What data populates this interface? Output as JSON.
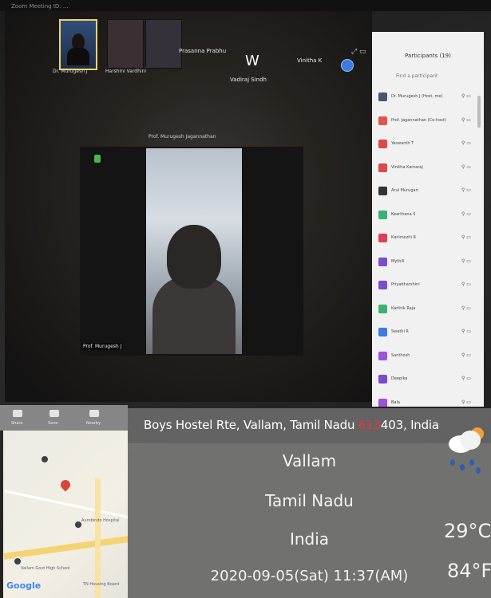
{
  "window": {
    "title": "Zoom Meeting ID: ..."
  },
  "video_strip": {
    "thumbs": [
      {
        "label": "Dr. Murugesh J"
      },
      {
        "label": "Harshini Vardhini"
      },
      {
        "label": ""
      }
    ],
    "name_tiles": [
      "Prasanna Prabhu",
      "Vadiraj Sindh",
      "Vinitha K"
    ],
    "w_letter": "W"
  },
  "speaker": {
    "caption": "Prof. Murugesh Jagannathan",
    "name_tag": "Prof. Murugesh J"
  },
  "participants_panel": {
    "title": "Participants (19)",
    "subtitle": "Find a participant",
    "rows": [
      {
        "name": "Dr. Murugesh J (Host, me)",
        "color": "#4b5563"
      },
      {
        "name": "Prof. Jagannathan (Co-host)",
        "color": "#e05546"
      },
      {
        "name": "Yaswanth T",
        "color": "#e04848"
      },
      {
        "name": "Vinitha Kamaraj",
        "color": "#d94a4a"
      },
      {
        "name": "Arul Murugan",
        "color": "#333333"
      },
      {
        "name": "Keerthana S",
        "color": "#3bb273"
      },
      {
        "name": "Kanimozhi R",
        "color": "#dd3f55"
      },
      {
        "name": "Mythili",
        "color": "#7a4ec9"
      },
      {
        "name": "Priyadharshini",
        "color": "#7a4ec9"
      },
      {
        "name": "Karthik Raja",
        "color": "#3bb273"
      },
      {
        "name": "Swathi R",
        "color": "#3d7be0"
      },
      {
        "name": "Santhosh",
        "color": "#9a55d9"
      },
      {
        "name": "Deepika",
        "color": "#7a4ec9"
      },
      {
        "name": "Bala",
        "color": "#9a55d9"
      }
    ]
  },
  "map_toolbar": {
    "items": [
      "Share",
      "Save",
      "Nearby"
    ]
  },
  "map": {
    "labels": [
      "Aurobindo Hospital",
      "Vallam Govt High School",
      "TN Housing Board"
    ],
    "brand": "Google"
  },
  "geo_tag": {
    "address_pre": "Boys Hostel Rte, Vallam, Tamil Nadu ",
    "address_red": "613",
    "address_mid": "403",
    "address_post": ", India",
    "city": "Vallam",
    "state": "Tamil Nadu",
    "country": "India",
    "datetime": "2020-09-05(Sat)  11:37(AM)",
    "temp_c": "29°C",
    "temp_f": "84°F",
    "weather_icon": "rain-cloud-sun-icon"
  }
}
